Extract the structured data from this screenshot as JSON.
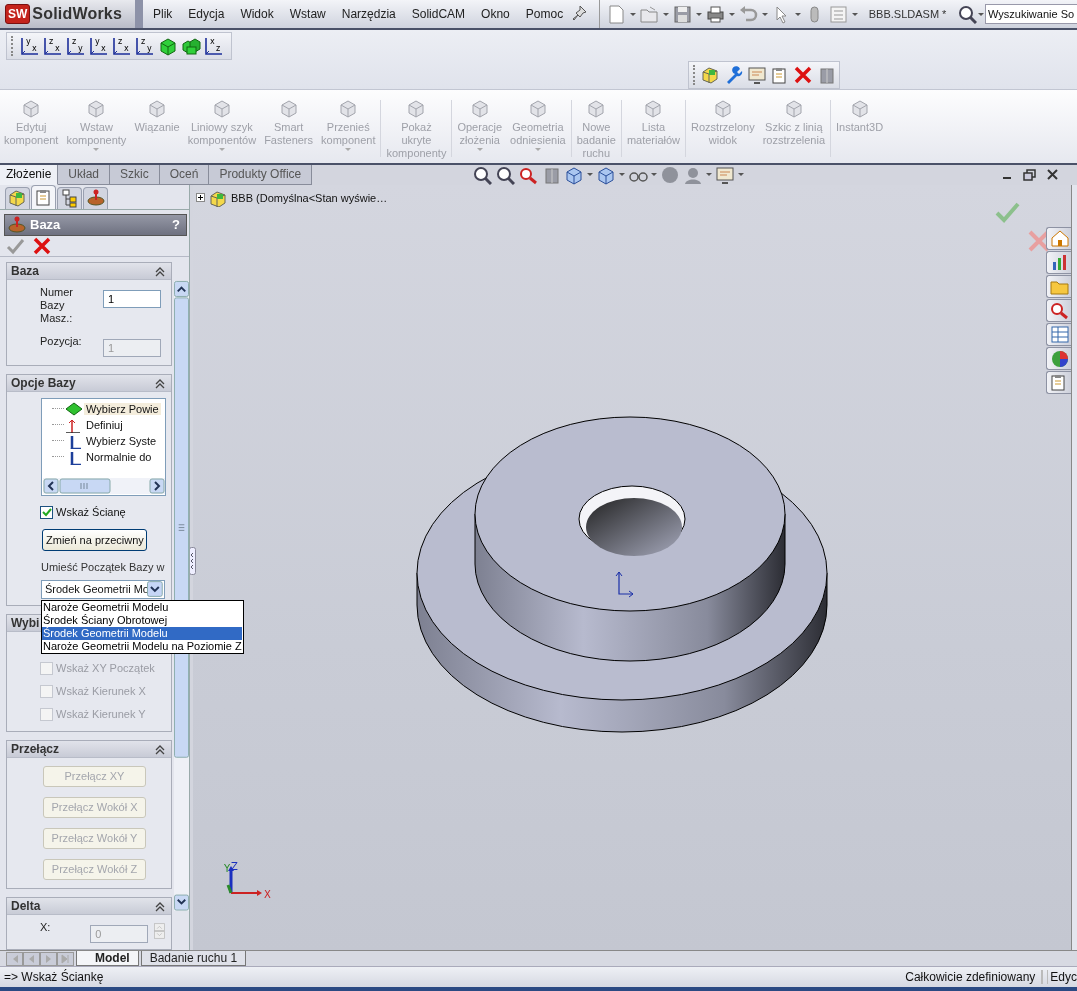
{
  "app": {
    "logo_mark": "SW",
    "logo_text": "SolidWorks"
  },
  "menu": [
    {
      "label": "Plik"
    },
    {
      "label": "Edycja"
    },
    {
      "label": "Widok"
    },
    {
      "label": "Wstaw"
    },
    {
      "label": "Narzędzia"
    },
    {
      "label": "SolidCAM"
    },
    {
      "label": "Okno"
    },
    {
      "label": "Pomoc"
    }
  ],
  "document_title": "BBB.SLDASM *",
  "search": {
    "placeholder": "Wyszukiwanie So"
  },
  "view_toolbar": [
    {
      "kind": "plane",
      "upper": "y",
      "lower": "x"
    },
    {
      "kind": "plane",
      "upper": "z",
      "lower": "x"
    },
    {
      "kind": "plane",
      "upper": "z",
      "lower": "y"
    },
    {
      "kind": "plane",
      "upper": "y",
      "lower": "x"
    },
    {
      "kind": "plane",
      "upper": "z",
      "lower": "x"
    },
    {
      "kind": "plane",
      "upper": "z",
      "lower": "y"
    },
    {
      "kind": "cube"
    },
    {
      "kind": "cubes"
    },
    {
      "kind": "plane",
      "upper": "x",
      "lower": "z"
    }
  ],
  "command_groups": [
    {
      "items": [
        {
          "lines": [
            "Edytuj",
            "komponent"
          ],
          "dropdown": false,
          "disabled": true
        },
        {
          "lines": [
            "Wstaw",
            "komponenty"
          ],
          "dropdown": true,
          "disabled": true
        },
        {
          "lines": [
            "Wiązanie"
          ],
          "dropdown": false,
          "disabled": true
        },
        {
          "lines": [
            "Liniowy szyk",
            "komponentów"
          ],
          "dropdown": true,
          "disabled": true
        },
        {
          "lines": [
            "Smart",
            "Fasteners"
          ],
          "dropdown": false,
          "disabled": true
        },
        {
          "lines": [
            "Przenieś",
            "komponent"
          ],
          "dropdown": true,
          "disabled": true
        }
      ]
    },
    {
      "items": [
        {
          "lines": [
            "Pokaż",
            "ukryte",
            "komponenty"
          ],
          "dropdown": false,
          "disabled": true
        }
      ]
    },
    {
      "items": [
        {
          "lines": [
            "Operacje",
            "złożenia"
          ],
          "dropdown": true,
          "disabled": true
        },
        {
          "lines": [
            "Geometria",
            "odniesienia"
          ],
          "dropdown": true,
          "disabled": true
        }
      ]
    },
    {
      "items": [
        {
          "lines": [
            "Nowe",
            "badanie",
            "ruchu"
          ],
          "dropdown": false,
          "disabled": true
        }
      ]
    },
    {
      "items": [
        {
          "lines": [
            "Lista",
            "materiałów"
          ],
          "dropdown": false,
          "disabled": true
        }
      ]
    },
    {
      "items": [
        {
          "lines": [
            "Rozstrzelony",
            "widok"
          ],
          "dropdown": false,
          "disabled": true
        },
        {
          "lines": [
            "Szkic z linią",
            "rozstrzelenia"
          ],
          "dropdown": false,
          "disabled": true
        }
      ]
    },
    {
      "items": [
        {
          "lines": [
            "Instant3D"
          ],
          "dropdown": false,
          "disabled": true
        }
      ]
    }
  ],
  "tabs": [
    {
      "label": "Złożenie",
      "selected": true
    },
    {
      "label": "Układ",
      "selected": false
    },
    {
      "label": "Szkic",
      "selected": false
    },
    {
      "label": "Oceń",
      "selected": false
    },
    {
      "label": "Produkty Office",
      "selected": false
    }
  ],
  "panel_tabs": [
    {
      "selected": false
    },
    {
      "selected": true
    },
    {
      "selected": false
    },
    {
      "selected": false
    }
  ],
  "property_manager": {
    "title": "Baza",
    "help": "?",
    "base_section": {
      "title": "Baza",
      "fields": [
        {
          "label": "Numer Bazy Masz.:",
          "value": "1",
          "disabled": false
        },
        {
          "label": "Pozycja:",
          "value": "1",
          "disabled": true
        }
      ]
    },
    "options_section": {
      "title": "Opcje Bazy",
      "list": [
        {
          "label": "Wybierz Powie",
          "selected": true
        },
        {
          "label": "Definiuj",
          "selected": false
        },
        {
          "label": "Wybierz Syste",
          "selected": false
        },
        {
          "label": "Normalnie do",
          "selected": false
        }
      ],
      "checkbox": {
        "label": "Wskaż Ścianę",
        "checked": true
      },
      "button": "Zmień na przeciwny",
      "origin_label": "Umieść Początek Bazy w",
      "select": {
        "value": "Środek Geometrii Mo",
        "expanded": true,
        "options": [
          {
            "label": "Naroże Geometrii Modelu",
            "selected": false
          },
          {
            "label": "Środek Ściany Obrotowej",
            "selected": false
          },
          {
            "label": "Środek Geometrii Modelu",
            "selected": true
          },
          {
            "label": "Naroże Geometrii Modelu na Poziomie Z",
            "selected": false
          }
        ]
      }
    },
    "pick_section": {
      "title": "Wybi",
      "checkboxes": [
        {
          "label": "Wskaż XY Początek",
          "checked": false,
          "disabled": true
        },
        {
          "label": "Wskaż Kierunek X",
          "checked": false,
          "disabled": true
        },
        {
          "label": "Wskaż Kierunek Y",
          "checked": false,
          "disabled": true
        }
      ]
    },
    "toggle_section": {
      "title": "Przełącz",
      "buttons": [
        {
          "label": "Przełącz  XY",
          "disabled": true
        },
        {
          "label": "Przełącz Wokół X",
          "disabled": true
        },
        {
          "label": "Przełącz Wokół Y",
          "disabled": true
        },
        {
          "label": "Przełącz Wokół Z",
          "disabled": true
        }
      ]
    },
    "delta_section": {
      "title": "Delta",
      "fields": [
        {
          "label": "X:",
          "value": "0",
          "disabled": true
        }
      ]
    }
  },
  "feature_tree": {
    "root": "BBB  (Domyślna<Stan wyświe…",
    "expanded": false
  },
  "triad": {
    "x": "X",
    "y": "Y",
    "z": "Z"
  },
  "bottom_tabs": [
    {
      "label": "Model",
      "selected": true
    },
    {
      "label": "Badanie ruchu 1",
      "selected": false
    }
  ],
  "status_bar": {
    "message": "=> Wskaż Ściankę",
    "state": "Całkowicie zdefiniowany",
    "mode": "Edyc"
  }
}
